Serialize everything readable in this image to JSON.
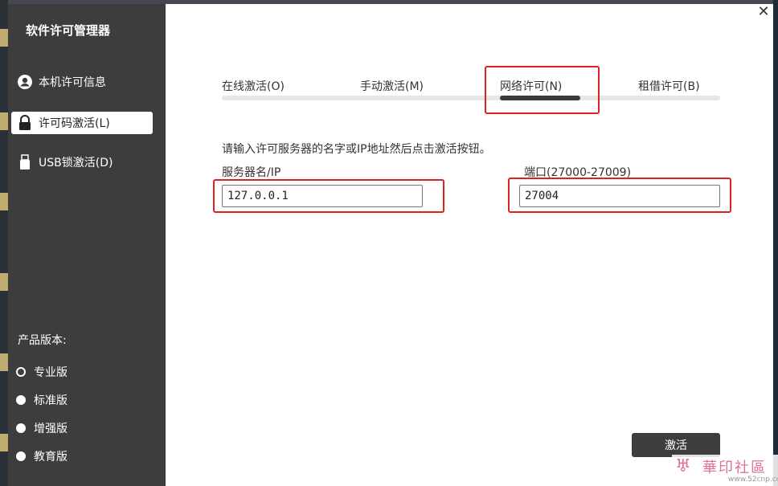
{
  "app": {
    "title": "软件许可管理器",
    "close_glyph": "✕"
  },
  "sidebar": {
    "items": [
      {
        "label": "本机许可信息",
        "icon": "user-icon",
        "active": false
      },
      {
        "label": "许可码激活(L)",
        "icon": "lock-icon",
        "active": true
      },
      {
        "label": "USB锁激活(D)",
        "icon": "usb-icon",
        "active": false
      }
    ],
    "edition_label": "产品版本:",
    "editions": [
      {
        "label": "专业版",
        "selected": true
      },
      {
        "label": "标准版",
        "selected": false
      },
      {
        "label": "增强版",
        "selected": false
      },
      {
        "label": "教育版",
        "selected": false
      }
    ]
  },
  "tabs": [
    {
      "label": "在线激活(O)",
      "active": false
    },
    {
      "label": "手动激活(M)",
      "active": false
    },
    {
      "label": "网络许可(N)",
      "active": true
    },
    {
      "label": "租借许可(B)",
      "active": false
    }
  ],
  "form": {
    "instruction": "请输入许可服务器的名字或IP地址然后点击激活按钮。",
    "server_label": "服务器名/IP",
    "server_value": "127.0.0.1",
    "port_label": "端口(27000-27009)",
    "port_value": "27004",
    "activate_label": "激活"
  },
  "watermark": {
    "title": "華印社區",
    "url": "www.52cnp.com"
  },
  "colors": {
    "sidebar_bg": "#3d3d3d",
    "highlight": "#e02020",
    "button_bg": "#3d3d3d"
  }
}
